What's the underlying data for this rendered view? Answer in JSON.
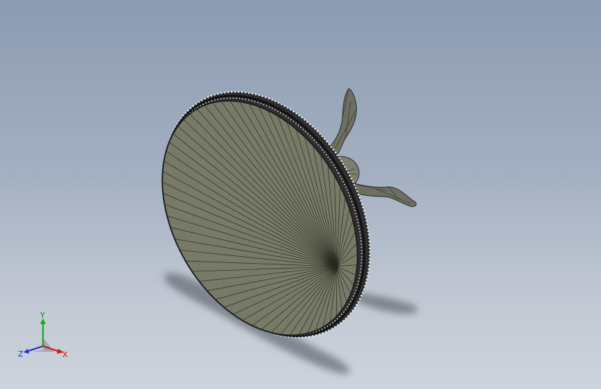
{
  "viewport": {
    "model": {
      "face_color": "#787a68",
      "rim_color": "#2d2d2d",
      "background_top": "#8c9bb1",
      "background_bottom": "#cdd3dc"
    },
    "triad": {
      "y_label": "Y",
      "z_label": "Z",
      "x_label": "X",
      "y_color": "#0a8a0a",
      "z_color": "#1b2fd8",
      "x_color": "#d01515"
    }
  }
}
